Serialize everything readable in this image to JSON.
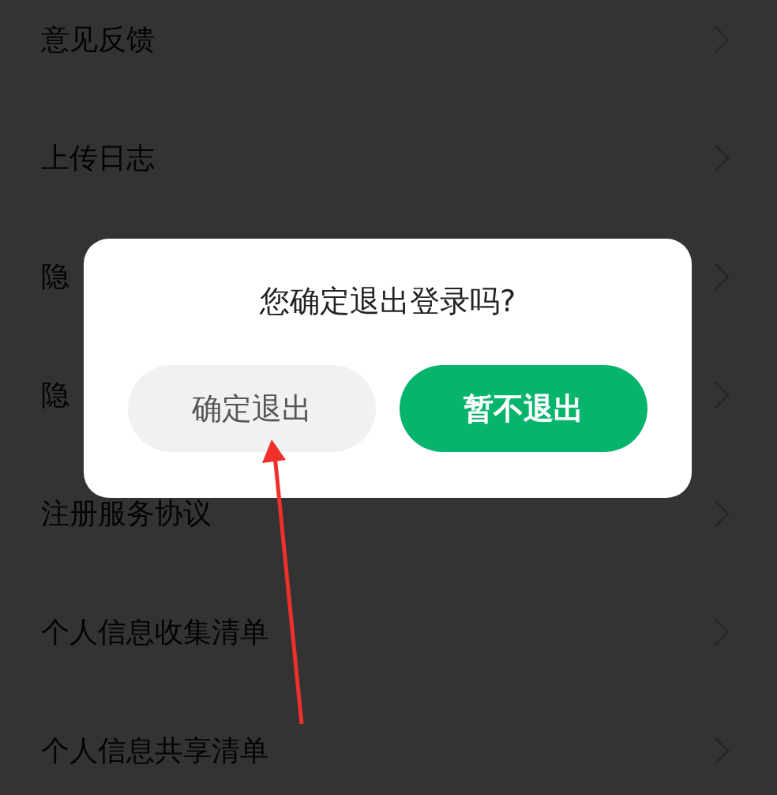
{
  "settings_list": [
    {
      "label": "意见反馈"
    },
    {
      "label": "上传日志"
    },
    {
      "label": "隐"
    },
    {
      "label": "隐"
    },
    {
      "label": "注册服务协议"
    },
    {
      "label": "个人信息收集清单"
    },
    {
      "label": "个人信息共享清单"
    }
  ],
  "dialog": {
    "title": "您确定退出登录吗?",
    "buttons": [
      {
        "label": "确定退出",
        "kind": "secondary"
      },
      {
        "label": "暂不退出",
        "kind": "primary"
      }
    ]
  }
}
